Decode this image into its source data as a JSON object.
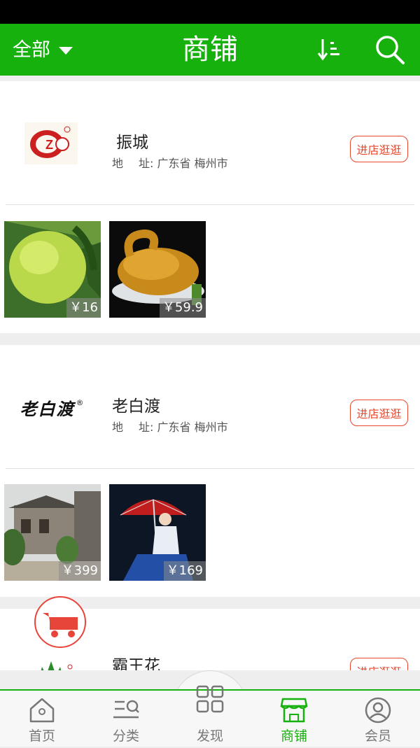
{
  "header": {
    "filter_label": "全部",
    "title": "商铺",
    "bg_color": "#16b10c"
  },
  "shops": [
    {
      "name": "振城",
      "address": "广东省 梅州市",
      "address_label_a": "地",
      "address_label_b": "址:",
      "visit_label": "进店逛逛",
      "logo": "zhencheng-logo",
      "products": [
        {
          "image": "pomelo-photo",
          "price": "￥16"
        },
        {
          "image": "roast-goose-photo",
          "price": "￥59.9"
        }
      ]
    },
    {
      "name": "老白渡",
      "address": "广东省 梅州市",
      "address_label_a": "地",
      "address_label_b": "址:",
      "visit_label": "进店逛逛",
      "logo_text": "老白渡",
      "products": [
        {
          "image": "old-building-photo",
          "price": "￥399"
        },
        {
          "image": "umbrella-girl-photo",
          "price": "￥169"
        }
      ]
    },
    {
      "name": "霸王花",
      "visit_label": "进店逛逛",
      "logo": "bawanghua-logo"
    }
  ],
  "bottom_nav": [
    {
      "label": "首页",
      "icon": "home-icon"
    },
    {
      "label": "分类",
      "icon": "category-icon"
    },
    {
      "label": "发现",
      "icon": "discover-icon"
    },
    {
      "label": "商铺",
      "icon": "shop-icon",
      "active": true
    },
    {
      "label": "会员",
      "icon": "member-icon"
    }
  ],
  "colors": {
    "accent": "#16b10c",
    "button": "#e8472b"
  }
}
